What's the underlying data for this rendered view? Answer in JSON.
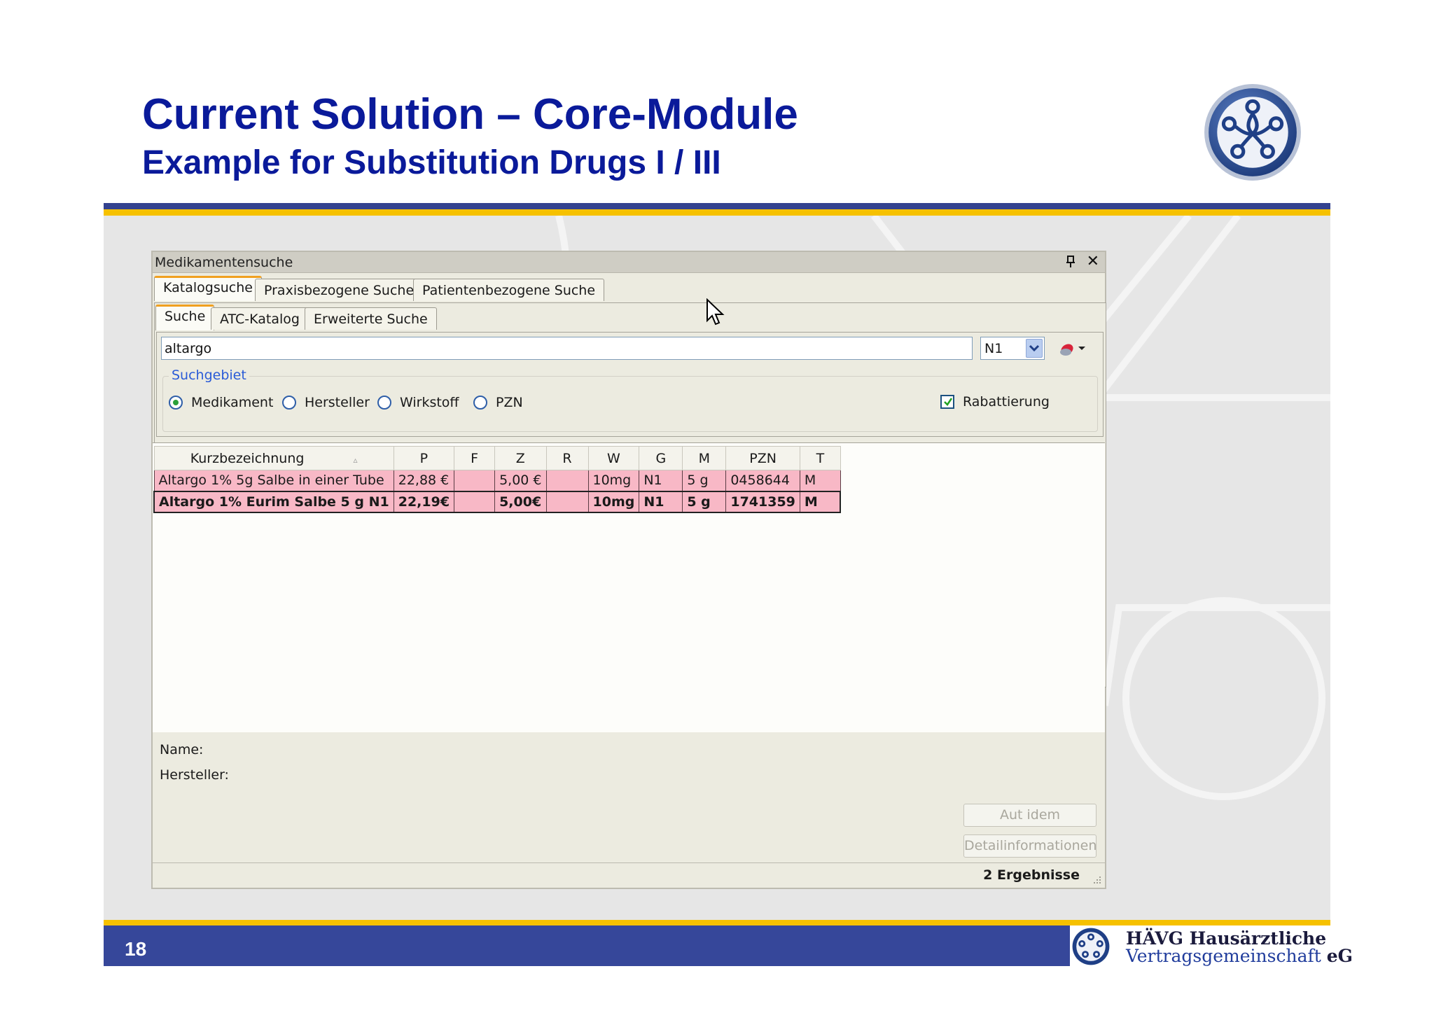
{
  "slide": {
    "title": "Current Solution – Core-Module",
    "subtitle": "Example for Substitution Drugs I / III",
    "page_number": "18",
    "footer_org_line1": "HÄVG Hausärztliche",
    "footer_org_line2": "Vertragsgemeinschaft",
    "footer_org_suffix": "eG",
    "logo_icon": "haevg-logo-icon",
    "colors": {
      "title": "#0a1a9a",
      "band_blue": "#36479a",
      "band_gold": "#f6c100"
    }
  },
  "window": {
    "title": "Medikamentensuche",
    "pin_icon": "pin-icon",
    "close_icon": "close-icon",
    "close_glyph": "✕",
    "main_tabs": [
      {
        "label": "Katalogsuche",
        "active": true
      },
      {
        "label": "Praxisbezogene Suche",
        "active": false
      },
      {
        "label": "Patientenbezogene Suche",
        "active": false
      }
    ],
    "sub_tabs": [
      {
        "label": "Suche",
        "active": true
      },
      {
        "label": "ATC-Katalog",
        "active": false
      },
      {
        "label": "Erweiterte Suche",
        "active": false
      }
    ],
    "search": {
      "value": "altargo"
    },
    "package_size": {
      "selected": "N1"
    },
    "search_area": {
      "label": "Suchgebiet",
      "options": [
        {
          "label": "Medikament",
          "selected": true
        },
        {
          "label": "Hersteller",
          "selected": false
        },
        {
          "label": "Wirkstoff",
          "selected": false
        },
        {
          "label": "PZN",
          "selected": false
        }
      ],
      "rebate_label": "Rabattierung",
      "rebate_checked": true
    },
    "grid": {
      "columns": [
        "Kurzbezeichnung",
        "P",
        "F",
        "Z",
        "R",
        "W",
        "G",
        "M",
        "PZN",
        "T"
      ],
      "rows": [
        {
          "name": "Altargo 1% 5g Salbe in einer Tube",
          "p": "22,88 €",
          "f": "",
          "z": "5,00 €",
          "r": "",
          "w": "10mg",
          "g": "N1",
          "m": "5 g",
          "pzn": "0458644",
          "t": "M",
          "bold": false
        },
        {
          "name": "Altargo 1% Eurim Salbe 5 g N1",
          "p": "22,19€",
          "f": "",
          "z": "5,00€",
          "r": "",
          "w": "10mg",
          "g": "N1",
          "m": "5 g",
          "pzn": "1741359",
          "t": "M",
          "bold": true
        }
      ],
      "row_color": "#f8b8c6"
    },
    "details": {
      "name_label": "Name:",
      "manufacturer_label": "Hersteller:"
    },
    "buttons": {
      "aut_idem": "Aut idem",
      "details": "Detailinformationen"
    },
    "status": "2 Ergebnisse"
  }
}
